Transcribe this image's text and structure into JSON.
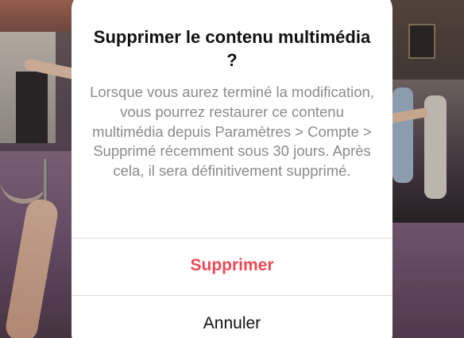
{
  "dialog": {
    "title": "Supprimer le contenu multimédia ?",
    "message": "Lorsque vous aurez terminé la modification, vous pourrez restaurer ce contenu multimédia depuis Paramètres > Compte > Supprimé récemment sous 30 jours. Après cela, il sera définitivement supprimé.",
    "delete_label": "Supprimer",
    "cancel_label": "Annuler"
  },
  "colors": {
    "destructive": "#ed4956",
    "title": "#111111",
    "message": "#8b8b8f",
    "divider": "#dcdcde"
  }
}
